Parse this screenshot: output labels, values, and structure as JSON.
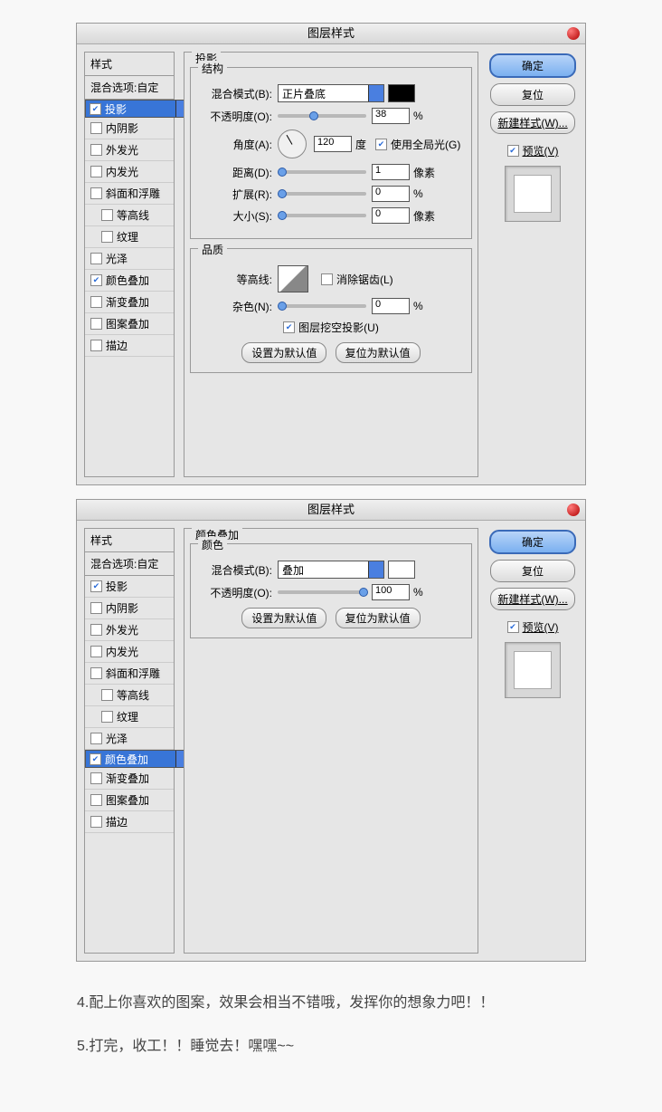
{
  "dialog1": {
    "title": "图层样式",
    "sidebar": {
      "hdr1": "样式",
      "hdr2": "混合选项:自定",
      "items": [
        {
          "label": "投影",
          "checked": true,
          "sel": true
        },
        {
          "label": "内阴影",
          "checked": false
        },
        {
          "label": "外发光",
          "checked": false
        },
        {
          "label": "内发光",
          "checked": false
        },
        {
          "label": "斜面和浮雕",
          "checked": false
        },
        {
          "label": "等高线",
          "checked": false,
          "ind": true
        },
        {
          "label": "纹理",
          "checked": false,
          "ind": true
        },
        {
          "label": "光泽",
          "checked": false
        },
        {
          "label": "颜色叠加",
          "checked": true
        },
        {
          "label": "渐变叠加",
          "checked": false
        },
        {
          "label": "图案叠加",
          "checked": false
        },
        {
          "label": "描边",
          "checked": false
        }
      ]
    },
    "main": {
      "group_label": "投影",
      "struct_label": "结构",
      "blend_label": "混合模式(B):",
      "blend_value": "正片叠底",
      "opacity_label": "不透明度(O):",
      "opacity_value": "38",
      "opacity_unit": "%",
      "angle_label": "角度(A):",
      "angle_value": "120",
      "angle_unit": "度",
      "global_label": "使用全局光(G)",
      "dist_label": "距离(D):",
      "dist_value": "1",
      "dist_unit": "像素",
      "spread_label": "扩展(R):",
      "spread_value": "0",
      "spread_unit": "%",
      "size_label": "大小(S):",
      "size_value": "0",
      "size_unit": "像素",
      "quality_label": "品质",
      "contour_label": "等高线:",
      "antialias_label": "消除锯齿(L)",
      "noise_label": "杂色(N):",
      "noise_value": "0",
      "noise_unit": "%",
      "knockout_label": "图层挖空投影(U)",
      "btn_default": "设置为默认值",
      "btn_reset": "复位为默认值"
    },
    "right": {
      "ok": "确定",
      "cancel": "复位",
      "newstyle": "新建样式(W)...",
      "preview": "预览(V)"
    }
  },
  "dialog2": {
    "title": "图层样式",
    "sidebar": {
      "hdr1": "样式",
      "hdr2": "混合选项:自定",
      "items": [
        {
          "label": "投影",
          "checked": true
        },
        {
          "label": "内阴影",
          "checked": false
        },
        {
          "label": "外发光",
          "checked": false
        },
        {
          "label": "内发光",
          "checked": false
        },
        {
          "label": "斜面和浮雕",
          "checked": false
        },
        {
          "label": "等高线",
          "checked": false,
          "ind": true
        },
        {
          "label": "纹理",
          "checked": false,
          "ind": true
        },
        {
          "label": "光泽",
          "checked": false
        },
        {
          "label": "颜色叠加",
          "checked": true,
          "sel": true
        },
        {
          "label": "渐变叠加",
          "checked": false
        },
        {
          "label": "图案叠加",
          "checked": false
        },
        {
          "label": "描边",
          "checked": false
        }
      ]
    },
    "main": {
      "group_label": "颜色叠加",
      "color_label": "颜色",
      "blend_label": "混合模式(B):",
      "blend_value": "叠加",
      "opacity_label": "不透明度(O):",
      "opacity_value": "100",
      "opacity_unit": "%",
      "btn_default": "设置为默认值",
      "btn_reset": "复位为默认值"
    },
    "right": {
      "ok": "确定",
      "cancel": "复位",
      "newstyle": "新建样式(W)...",
      "preview": "预览(V)"
    }
  },
  "article": {
    "p1": "4.配上你喜欢的图案，效果会相当不错哦，发挥你的想象力吧！！",
    "p2": "5.打完，收工！！睡觉去！嘿嘿~~"
  }
}
